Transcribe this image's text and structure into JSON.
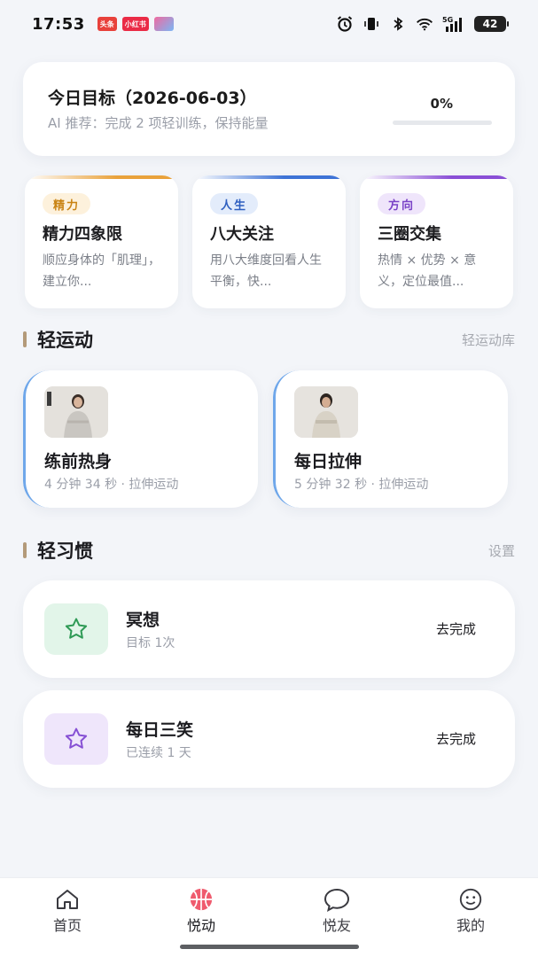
{
  "status_bar": {
    "time": "17:53",
    "apps": [
      {
        "label": "头条",
        "color": "#e8413b"
      },
      {
        "label": "小红书",
        "color": "#ea2b46"
      },
      {
        "label": "",
        "color": "#f06aa0"
      }
    ],
    "battery": "42",
    "network": "5G"
  },
  "goal": {
    "title": "今日目标（2026-06-03）",
    "ai_tip": "AI 推荐：完成 2 项轻训练，保持能量",
    "percent_text": "0%",
    "progress": 0
  },
  "features": [
    {
      "tag": "精力",
      "title": "精力四象限",
      "desc": "顺应身体的「肌理」，建立你...",
      "accent": "#e9a23b",
      "tag_bg": "#fdf1dc",
      "tag_color": "#c98313"
    },
    {
      "tag": "人生",
      "title": "八大关注",
      "desc": "用八大维度回看人生平衡，快...",
      "accent": "#3e73d6",
      "tag_bg": "#e3ecfb",
      "tag_color": "#2e5fc0"
    },
    {
      "tag": "方向",
      "title": "三圈交集",
      "desc": "热情 × 优势 × 意义，定位最值...",
      "accent": "#8a4fd6",
      "tag_bg": "#efe5fb",
      "tag_color": "#7a43c7"
    }
  ],
  "light_exercise": {
    "title": "轻运动",
    "link": "轻运动库",
    "items": [
      {
        "title": "练前热身",
        "meta": "4 分钟 34 秒 · 拉伸运动"
      },
      {
        "title": "每日拉伸",
        "meta": "5 分钟 32 秒 · 拉伸运动"
      }
    ]
  },
  "light_habit": {
    "title": "轻习惯",
    "link": "设置",
    "items": [
      {
        "name": "冥想",
        "meta": "目标 1次",
        "action": "去完成",
        "icon": "star-icon",
        "icon_bg": "#e2f5e9",
        "icon_color": "#2e9a55"
      },
      {
        "name": "每日三笑",
        "meta": "已连续 1 天",
        "action": "去完成",
        "icon": "star-icon",
        "icon_bg": "#efe6fb",
        "icon_color": "#8650d4"
      }
    ]
  },
  "nav": [
    {
      "label": "首页",
      "icon": "home-icon"
    },
    {
      "label": "悦动",
      "icon": "basketball-icon",
      "active": true
    },
    {
      "label": "悦友",
      "icon": "chat-bubble-icon"
    },
    {
      "label": "我的",
      "icon": "smile-face-icon"
    }
  ]
}
